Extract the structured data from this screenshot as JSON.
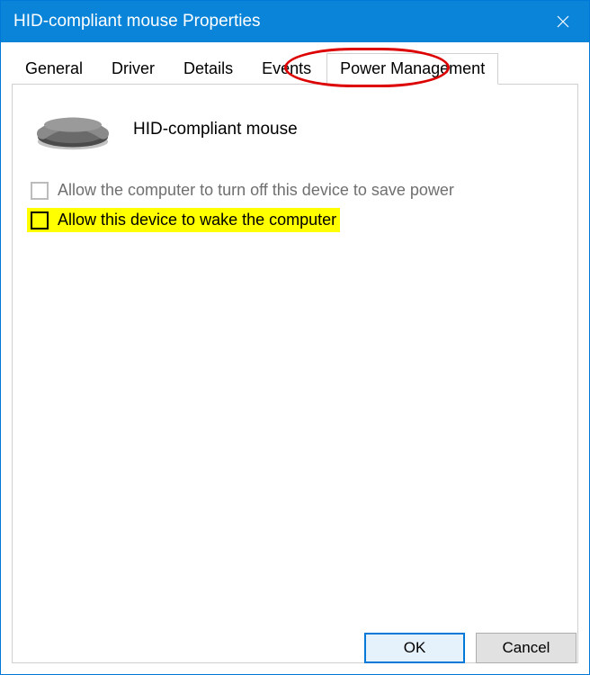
{
  "titlebar": {
    "title": "HID-compliant mouse Properties"
  },
  "tabs": [
    {
      "label": "General"
    },
    {
      "label": "Driver"
    },
    {
      "label": "Details"
    },
    {
      "label": "Events"
    },
    {
      "label": "Power Management"
    }
  ],
  "device": {
    "name": "HID-compliant mouse"
  },
  "checkboxes": {
    "power_off_label": "Allow the computer to turn off this device to save power",
    "wake_label": "Allow this device to wake the computer"
  },
  "buttons": {
    "ok": "OK",
    "cancel": "Cancel"
  }
}
